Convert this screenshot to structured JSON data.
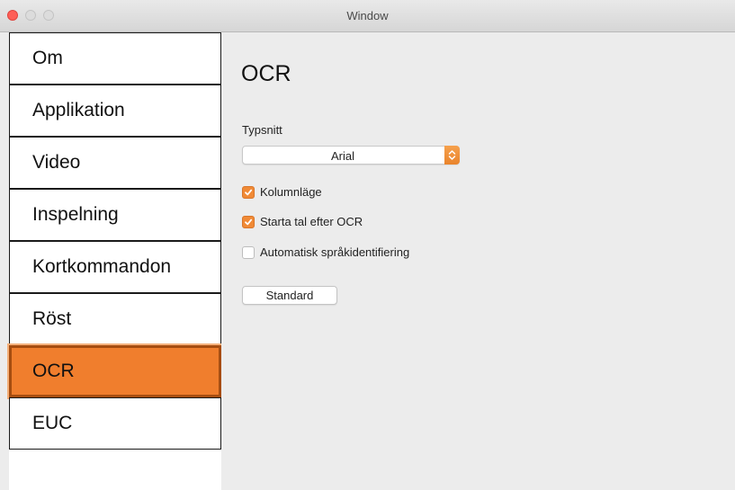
{
  "window": {
    "title": "Window"
  },
  "sidebar": {
    "items": [
      {
        "label": "Om",
        "active": false
      },
      {
        "label": "Applikation",
        "active": false
      },
      {
        "label": "Video",
        "active": false
      },
      {
        "label": "Inspelning",
        "active": false
      },
      {
        "label": "Kortkommandon",
        "active": false
      },
      {
        "label": "Röst",
        "active": false
      },
      {
        "label": "OCR",
        "active": true
      },
      {
        "label": "EUC",
        "active": false
      }
    ]
  },
  "main": {
    "title": "OCR",
    "font_label": "Typsnitt",
    "font_select": {
      "value": "Arial"
    },
    "checkboxes": [
      {
        "label": "Kolumnläge",
        "checked": true
      },
      {
        "label": "Starta tal efter OCR",
        "checked": true
      },
      {
        "label": "Automatisk språkidentifiering",
        "checked": false
      }
    ],
    "default_button": "Standard"
  },
  "colors": {
    "accent": "#f07e2d",
    "close_button": "#fe5f57"
  },
  "icons": {
    "select": "up-down-chevron-icon",
    "checkbox_checked": "checkmark-icon"
  }
}
